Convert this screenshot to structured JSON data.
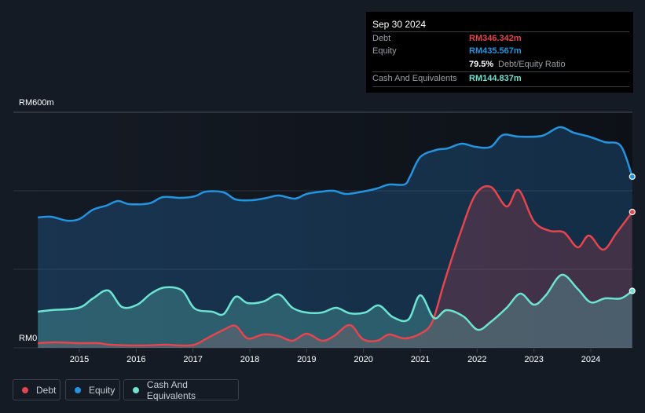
{
  "tooltip": {
    "date": "Sep 30 2024",
    "rows": [
      {
        "label": "Debt",
        "value": "RM346.342m",
        "color": "#e5454d"
      },
      {
        "label": "Equity",
        "value": "RM435.567m",
        "color": "#2394df"
      },
      {
        "label": "",
        "value": "79.5%",
        "suffix": "Debt/Equity Ratio",
        "color": "#ffffff"
      },
      {
        "label": "Cash And Equivalents",
        "value": "RM144.837m",
        "color": "#6de3d2"
      }
    ]
  },
  "legend": [
    {
      "label": "Debt",
      "color": "#e5454d"
    },
    {
      "label": "Equity",
      "color": "#2394df"
    },
    {
      "label": "Cash And Equivalents",
      "color": "#6de3d2"
    }
  ],
  "chart_data": {
    "type": "area",
    "title": "",
    "xlabel": "",
    "ylabel": "",
    "ylim": [
      0,
      600
    ],
    "xlim": [
      2014.0,
      2024.75
    ],
    "y_tick_labels": [
      "RM0",
      "RM600m"
    ],
    "x_ticks": [
      "2015",
      "2016",
      "2017",
      "2018",
      "2019",
      "2020",
      "2021",
      "2022",
      "2023",
      "2024"
    ],
    "series": [
      {
        "name": "Equity",
        "color": "#2394df",
        "points": [
          [
            14.27,
            332
          ],
          [
            14.5,
            334
          ],
          [
            14.78,
            324
          ],
          [
            15.0,
            328
          ],
          [
            15.24,
            352
          ],
          [
            15.47,
            362
          ],
          [
            15.68,
            374
          ],
          [
            15.88,
            366
          ],
          [
            16.23,
            368
          ],
          [
            16.47,
            384
          ],
          [
            16.78,
            382
          ],
          [
            17.03,
            386
          ],
          [
            17.23,
            398
          ],
          [
            17.54,
            396
          ],
          [
            17.75,
            378
          ],
          [
            18.03,
            376
          ],
          [
            18.3,
            382
          ],
          [
            18.51,
            388
          ],
          [
            18.79,
            380
          ],
          [
            19.0,
            392
          ],
          [
            19.27,
            398
          ],
          [
            19.48,
            400
          ],
          [
            19.69,
            392
          ],
          [
            19.99,
            398
          ],
          [
            20.24,
            406
          ],
          [
            20.45,
            416
          ],
          [
            20.72,
            416
          ],
          [
            20.82,
            436
          ],
          [
            21.0,
            486
          ],
          [
            21.28,
            504
          ],
          [
            21.48,
            508
          ],
          [
            21.73,
            520
          ],
          [
            21.97,
            512
          ],
          [
            22.24,
            512
          ],
          [
            22.45,
            542
          ],
          [
            22.73,
            538
          ],
          [
            23.14,
            540
          ],
          [
            23.45,
            562
          ],
          [
            23.7,
            548
          ],
          [
            23.97,
            538
          ],
          [
            24.25,
            524
          ],
          [
            24.53,
            514
          ],
          [
            24.73,
            436
          ]
        ]
      },
      {
        "name": "Debt",
        "color": "#e5454d",
        "points": [
          [
            14.27,
            12
          ],
          [
            14.57,
            14
          ],
          [
            14.99,
            12
          ],
          [
            15.33,
            12
          ],
          [
            15.54,
            8
          ],
          [
            16.09,
            6
          ],
          [
            16.51,
            8
          ],
          [
            16.78,
            6
          ],
          [
            17.03,
            8
          ],
          [
            17.27,
            26
          ],
          [
            17.54,
            46
          ],
          [
            17.75,
            56
          ],
          [
            17.96,
            24
          ],
          [
            18.24,
            34
          ],
          [
            18.51,
            30
          ],
          [
            18.75,
            18
          ],
          [
            19.0,
            36
          ],
          [
            19.27,
            18
          ],
          [
            19.48,
            30
          ],
          [
            19.76,
            58
          ],
          [
            19.99,
            22
          ],
          [
            20.24,
            18
          ],
          [
            20.45,
            34
          ],
          [
            20.72,
            24
          ],
          [
            21.0,
            36
          ],
          [
            21.21,
            66
          ],
          [
            21.42,
            166
          ],
          [
            21.69,
            286
          ],
          [
            21.97,
            390
          ],
          [
            22.24,
            410
          ],
          [
            22.52,
            360
          ],
          [
            22.73,
            402
          ],
          [
            23.0,
            322
          ],
          [
            23.28,
            298
          ],
          [
            23.53,
            294
          ],
          [
            23.77,
            256
          ],
          [
            23.97,
            286
          ],
          [
            24.22,
            250
          ],
          [
            24.46,
            294
          ],
          [
            24.73,
            346
          ]
        ]
      },
      {
        "name": "Cash And Equivalents",
        "color": "#6de3d2",
        "points": [
          [
            14.27,
            92
          ],
          [
            14.5,
            96
          ],
          [
            14.99,
            102
          ],
          [
            15.24,
            126
          ],
          [
            15.51,
            146
          ],
          [
            15.75,
            104
          ],
          [
            16.02,
            110
          ],
          [
            16.26,
            138
          ],
          [
            16.51,
            154
          ],
          [
            16.81,
            146
          ],
          [
            17.03,
            100
          ],
          [
            17.34,
            92
          ],
          [
            17.54,
            86
          ],
          [
            17.75,
            130
          ],
          [
            17.96,
            114
          ],
          [
            18.24,
            118
          ],
          [
            18.51,
            136
          ],
          [
            18.75,
            102
          ],
          [
            19.0,
            90
          ],
          [
            19.27,
            90
          ],
          [
            19.52,
            102
          ],
          [
            19.76,
            88
          ],
          [
            20.03,
            90
          ],
          [
            20.27,
            108
          ],
          [
            20.52,
            78
          ],
          [
            20.79,
            72
          ],
          [
            21.0,
            134
          ],
          [
            21.24,
            76
          ],
          [
            21.46,
            96
          ],
          [
            21.76,
            80
          ],
          [
            22.01,
            46
          ],
          [
            22.24,
            66
          ],
          [
            22.52,
            102
          ],
          [
            22.76,
            138
          ],
          [
            23.0,
            110
          ],
          [
            23.21,
            134
          ],
          [
            23.49,
            186
          ],
          [
            23.77,
            150
          ],
          [
            24.0,
            116
          ],
          [
            24.25,
            126
          ],
          [
            24.53,
            126
          ],
          [
            24.73,
            145
          ]
        ]
      }
    ]
  }
}
